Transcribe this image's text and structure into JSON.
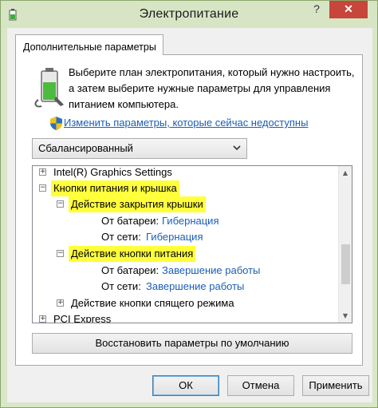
{
  "window": {
    "title": "Электропитание",
    "help_glyph": "?",
    "close_glyph": "✕"
  },
  "tab": {
    "label": "Дополнительные параметры"
  },
  "description": "Выберите план электропитания, который нужно настроить, а затем выберите нужные параметры для управления питанием компьютера.",
  "change_link": "Изменить параметры, которые сейчас недоступны",
  "plan_select": {
    "value": "Сбалансированный"
  },
  "tree": {
    "intel": {
      "label": "Intel(R) Graphics Settings",
      "exp": "+"
    },
    "power_buttons": {
      "label": "Кнопки питания и крышка",
      "exp": "−"
    },
    "lid_close": {
      "label": "Действие закрытия крышки",
      "exp": "−"
    },
    "lid_battery": {
      "label": "От батареи:",
      "value": "Гибернация"
    },
    "lid_ac": {
      "label": "От сети:",
      "value": "Гибернация"
    },
    "power_button": {
      "label": "Действие кнопки питания",
      "exp": "−"
    },
    "pb_battery": {
      "label": "От батареи:",
      "value": "Завершение работы"
    },
    "pb_ac": {
      "label": "От сети:",
      "value": "Завершение работы"
    },
    "sleep_button": {
      "label": "Действие кнопки спящего режима",
      "exp": "+"
    },
    "pci": {
      "label": "PCI Express",
      "exp": "+"
    }
  },
  "scrollbar": {
    "up_glyph": "▲",
    "down_glyph": "▼"
  },
  "buttons": {
    "restore": "Восстановить параметры по умолчанию",
    "ok": "ОК",
    "cancel": "Отмена",
    "apply": "Применить"
  },
  "colors": {
    "highlight": "#ffff3b",
    "link": "#1a5fb4",
    "close_button": "#c7453a"
  }
}
